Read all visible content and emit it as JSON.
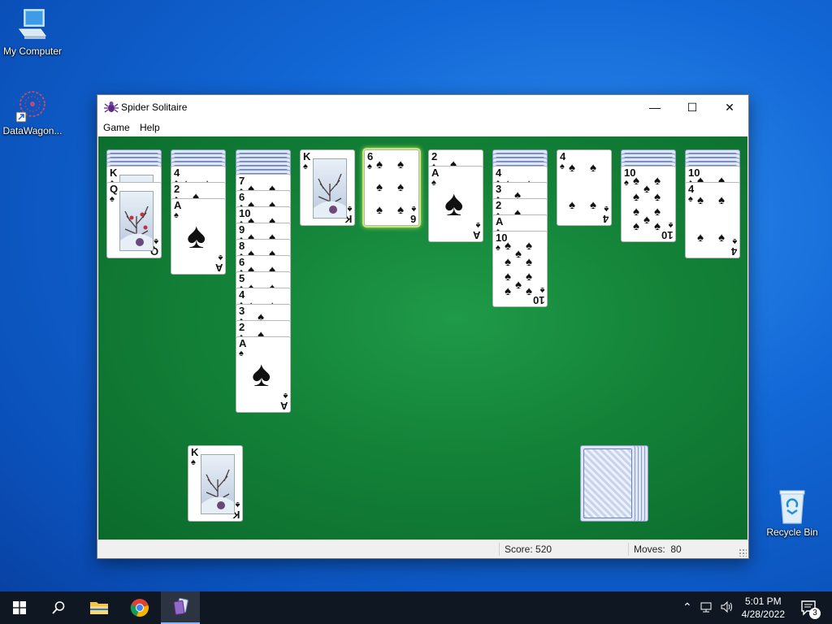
{
  "desktop": {
    "icons": [
      {
        "label": "My Computer"
      },
      {
        "label": "DataWagon..."
      },
      {
        "label": "Recycle Bin"
      }
    ]
  },
  "window": {
    "title": "Spider Solitaire",
    "controls": {
      "minimize": "—",
      "maximize": "☐",
      "close": "✕"
    },
    "menu": [
      "Game",
      "Help"
    ]
  },
  "status": {
    "score_label": "Score:",
    "score_value": "520",
    "moves_label": "Moves:",
    "moves_value": "80"
  },
  "game": {
    "suit": "♠",
    "columns": [
      {
        "hidden": 4,
        "face_up": [
          "K",
          "Q"
        ]
      },
      {
        "hidden": 4,
        "face_up": [
          "4",
          "2",
          "A"
        ]
      },
      {
        "hidden": 6,
        "face_up": [
          "7",
          "6",
          "10",
          "9",
          "8",
          "6",
          "5",
          "4",
          "3",
          "2",
          "A"
        ]
      },
      {
        "hidden": 0,
        "face_up": [
          "K"
        ]
      },
      {
        "hidden": 0,
        "face_up": [
          "6"
        ]
      },
      {
        "hidden": 0,
        "face_up": [
          "2",
          "A"
        ]
      },
      {
        "hidden": 4,
        "face_up": [
          "4",
          "3",
          "2",
          "A",
          "10"
        ]
      },
      {
        "hidden": 0,
        "face_up": [
          "4"
        ]
      },
      {
        "hidden": 4,
        "face_up": [
          "10"
        ]
      },
      {
        "hidden": 4,
        "face_up": [
          "10",
          "4"
        ]
      }
    ],
    "completed_foundation": [
      "K"
    ],
    "stock_piles": 5,
    "selected_card": "6"
  },
  "taskbar": {
    "time": "5:01 PM",
    "date": "4/28/2022",
    "notifications": "3"
  },
  "colors": {
    "felt": "#138238",
    "taskbar": "#0f1722",
    "desktop": "#1268d6"
  }
}
